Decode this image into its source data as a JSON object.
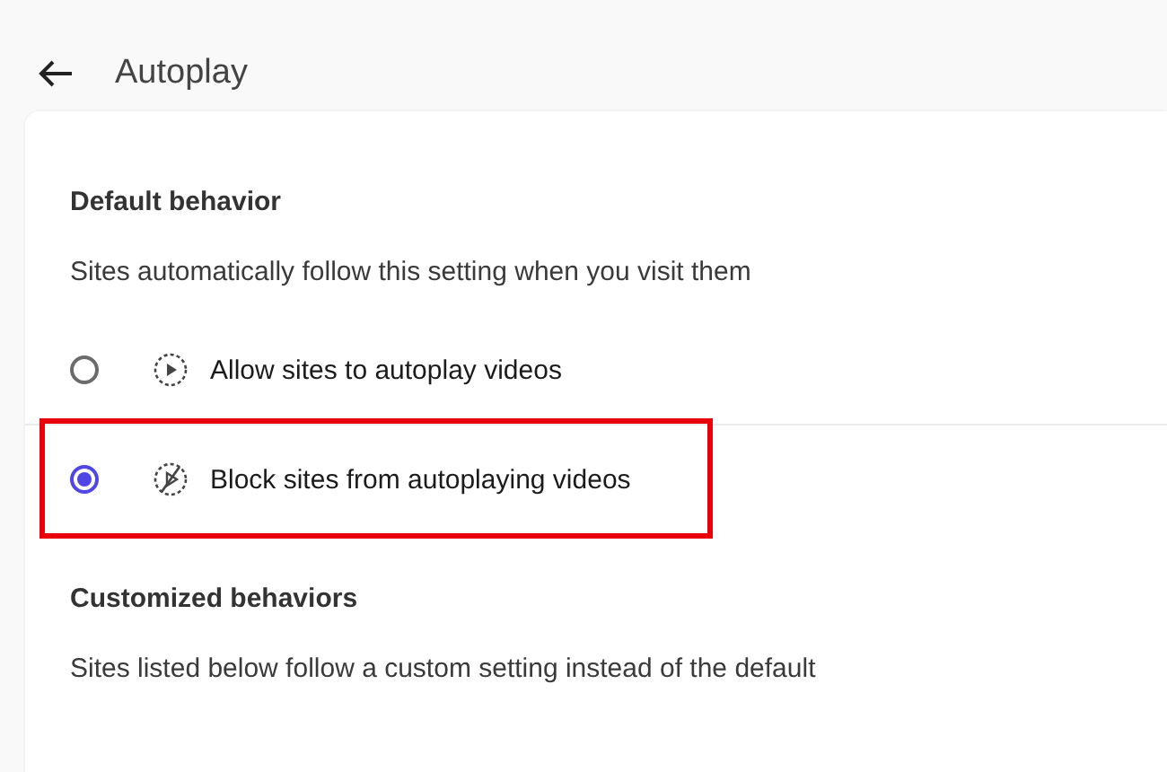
{
  "header": {
    "title": "Autoplay"
  },
  "sections": [
    {
      "heading": "Default behavior",
      "description": "Sites automatically follow this setting when you visit them",
      "options": [
        {
          "label": "Allow sites to autoplay videos",
          "kind": "play",
          "selected": false,
          "highlighted": false
        },
        {
          "label": "Block sites from autoplaying videos",
          "kind": "blocked",
          "selected": true,
          "highlighted": true
        }
      ]
    },
    {
      "heading": "Customized behaviors",
      "description": "Sites listed below follow a custom setting instead of the default"
    }
  ]
}
